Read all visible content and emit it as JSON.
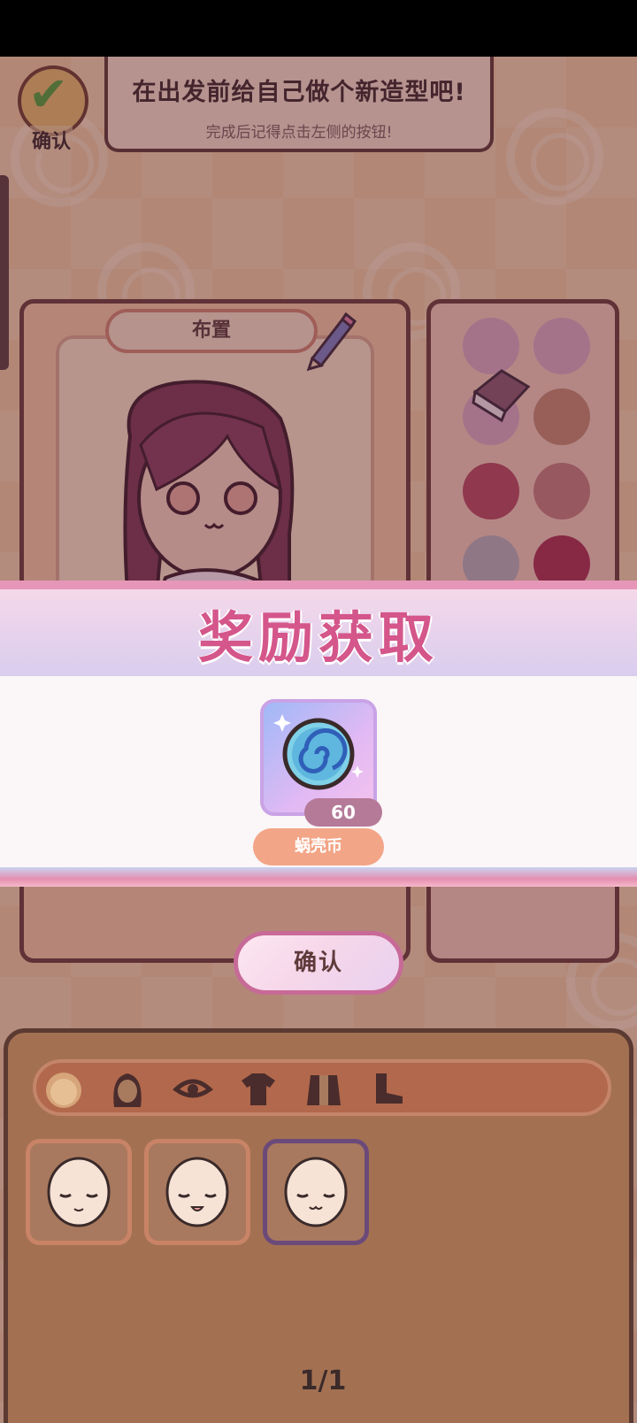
{
  "top": {
    "confirm_label": "确认",
    "tip_title": "在出发前给自己做个新造型吧!",
    "tip_subtitle": "完成后记得点击左侧的按钮!"
  },
  "character_panel": {
    "layout_label": "布置"
  },
  "palette": {
    "swatches": [
      "#d9a8bf",
      "#d9a8bf",
      "#d9a8bf",
      "#c48870",
      "#b9495f",
      "#c57d7d",
      "#b8aeb9",
      "#aa3152"
    ]
  },
  "reward": {
    "title": "奖励获取",
    "item_count": "60",
    "item_name": "蜗壳币"
  },
  "confirm_button": "确认",
  "drawer": {
    "categories": [
      "face-icon",
      "hair-icon",
      "eyes-icon",
      "top-icon",
      "outfit-icon",
      "shoes-icon"
    ],
    "page_indicator": "1/1"
  },
  "colors": {
    "reward_title": "#d4568b",
    "item_name_bg": "#f3a587",
    "count_bg": "#b57a98"
  }
}
